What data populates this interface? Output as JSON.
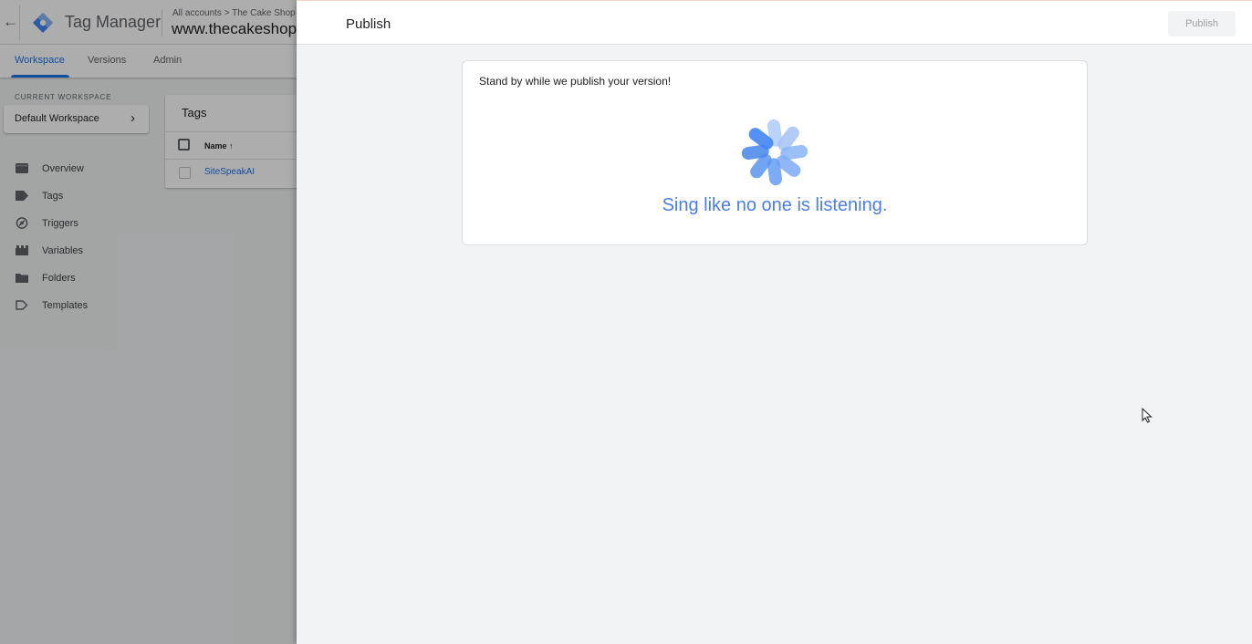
{
  "app": {
    "title": "Tag Manager",
    "breadcrumb": "All accounts > The Cake Shop",
    "container_name": "www.thecakeshop",
    "nav_tabs": [
      {
        "label": "Workspace",
        "active": true
      },
      {
        "label": "Versions",
        "active": false
      },
      {
        "label": "Admin",
        "active": false
      }
    ],
    "workspace": {
      "label": "CURRENT WORKSPACE",
      "name": "Default Workspace"
    },
    "sidebar": {
      "items": [
        {
          "label": "Overview",
          "icon": "overview-icon"
        },
        {
          "label": "Tags",
          "icon": "tag-icon"
        },
        {
          "label": "Triggers",
          "icon": "trigger-icon"
        },
        {
          "label": "Variables",
          "icon": "variables-icon"
        },
        {
          "label": "Folders",
          "icon": "folder-icon"
        },
        {
          "label": "Templates",
          "icon": "template-icon"
        }
      ]
    },
    "tags_card": {
      "title": "Tags",
      "column_name": "Name ↑",
      "rows": [
        {
          "name": "SiteSpeakAI"
        }
      ]
    }
  },
  "publish_panel": {
    "title": "Publish",
    "publish_button": "Publish",
    "status_text": "Stand by while we publish your version!",
    "quote": "Sing like no one is listening."
  },
  "colors": {
    "accent": "#1a73e8",
    "quote": "#4a7fe0",
    "panel_background": "#f1f3f4"
  }
}
